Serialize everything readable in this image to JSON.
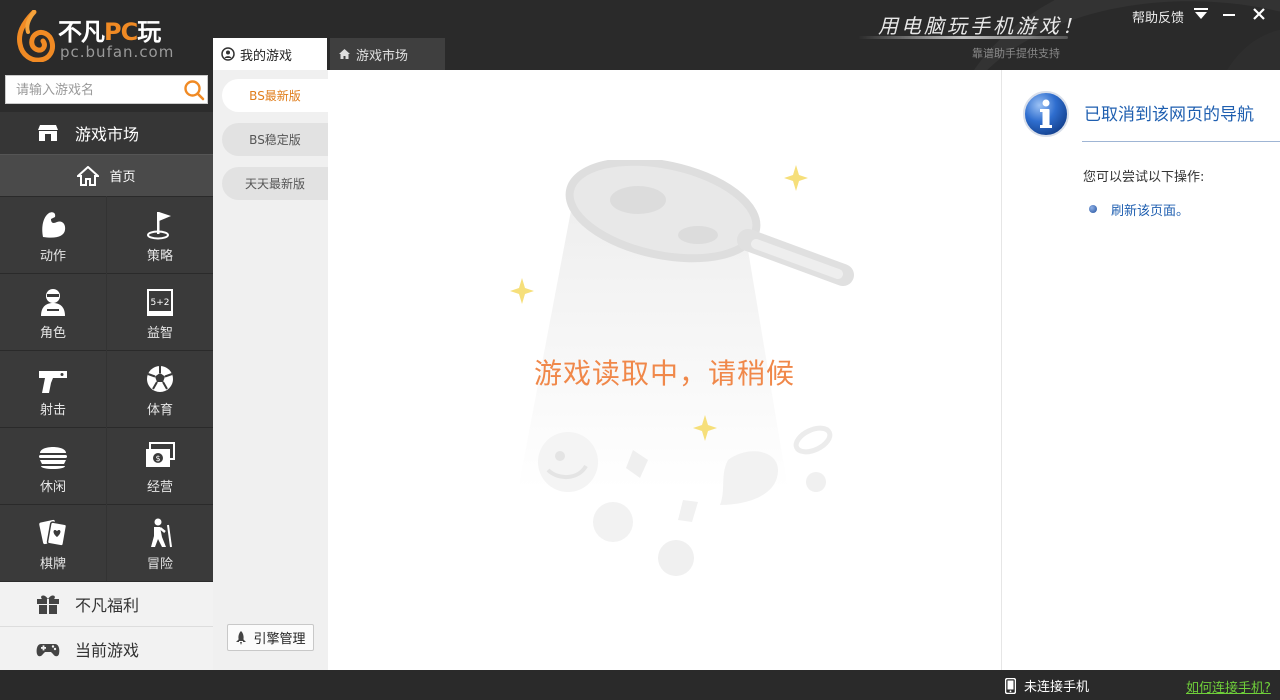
{
  "app": {
    "logo_title_main": "不凡",
    "logo_title_pc": "PC",
    "logo_title_end": "玩",
    "logo_url": "pc.bufan.com",
    "slogan": "用电脑玩手机游戏！",
    "slogan_sub": "靠谱助手提供支持",
    "help_label": "帮助反馈"
  },
  "tabs": [
    {
      "label": "我的游戏",
      "icon": "user-circle-icon",
      "active": true
    },
    {
      "label": "游戏市场",
      "icon": "home-icon",
      "active": false
    }
  ],
  "sidebar": {
    "search_placeholder": "请输入游戏名",
    "market_label": "游戏市场",
    "home_label": "首页",
    "categories": [
      {
        "label": "动作",
        "icon": "muscle-arm-icon"
      },
      {
        "label": "策略",
        "icon": "flag-icon"
      },
      {
        "label": "角色",
        "icon": "character-icon"
      },
      {
        "label": "益智",
        "icon": "math-board-icon"
      },
      {
        "label": "射击",
        "icon": "pistol-icon"
      },
      {
        "label": "体育",
        "icon": "soccer-ball-icon"
      },
      {
        "label": "休闲",
        "icon": "burger-icon"
      },
      {
        "label": "经营",
        "icon": "money-icon"
      },
      {
        "label": "棋牌",
        "icon": "cards-icon"
      },
      {
        "label": "冒险",
        "icon": "hiker-icon"
      }
    ],
    "welfare_label": "不凡福利",
    "current_label": "当前游戏"
  },
  "versions": [
    {
      "label": "BS最新版",
      "active": true
    },
    {
      "label": "BS稳定版",
      "active": false
    },
    {
      "label": "天天最新版",
      "active": false
    }
  ],
  "engine_label": "引擎管理",
  "main": {
    "loading_text": "游戏读取中，请稍候"
  },
  "nav_panel": {
    "title": "已取消到该网页的导航",
    "desc": "您可以尝试以下操作:",
    "link": "刷新该页面。"
  },
  "status": {
    "phone_text": "未连接手机",
    "connect_link": "如何连接手机?"
  },
  "colors": {
    "accent": "#f08a24",
    "loading_text": "#f0884a",
    "link_blue": "#1f5fb0",
    "status_link": "#6fcf3a"
  }
}
